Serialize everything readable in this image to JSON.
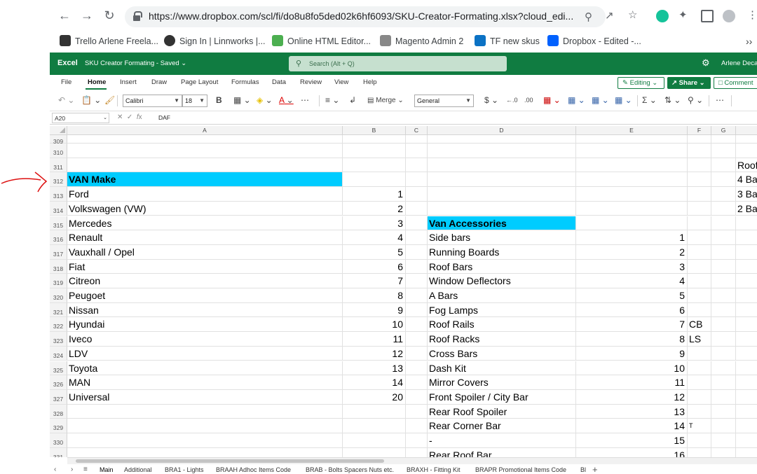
{
  "browser": {
    "url": "https://www.dropbox.com/scl/fi/do8u8fo5ded02k6hf6093/SKU-Creator-Formating.xlsx?cloud_edi...",
    "bookmarks": [
      {
        "label": "Trello Arlene Freela...",
        "color": "#333333"
      },
      {
        "label": "Sign In | Linnworks |...",
        "color": "#333333"
      },
      {
        "label": "Online HTML Editor...",
        "color": "#4caf50"
      },
      {
        "label": "Magento Admin 2",
        "color": "#666666"
      },
      {
        "label": "TF new skus",
        "color": "#0b72c4"
      },
      {
        "label": "Dropbox - Edited -...",
        "color": "#0061fe"
      }
    ]
  },
  "excel": {
    "app_name": "Excel",
    "file_title": "SKU Creator Formating - Saved",
    "search_placeholder": "Search (Alt + Q)",
    "user_name": "Arlene Deca",
    "tabs": [
      "File",
      "Home",
      "Insert",
      "Draw",
      "Page Layout",
      "Formulas",
      "Data",
      "Review",
      "View",
      "Help"
    ],
    "editing_label": "Editing",
    "share_label": "Share",
    "comments_label": "Comment",
    "font_name": "Calibri",
    "font_size": "18",
    "merge_label": "Merge",
    "number_format": "General",
    "namebox": "A20",
    "formula_value": "DAF"
  },
  "grid": {
    "columns": [
      "A",
      "B",
      "C",
      "D",
      "E",
      "F",
      "G",
      ""
    ],
    "rows": [
      {
        "n": "309",
        "a": "",
        "b": "",
        "d": "",
        "e": "",
        "f": "",
        "h": ""
      },
      {
        "n": "310",
        "a": "",
        "b": "",
        "d": "",
        "e": "",
        "f": "",
        "h": ""
      },
      {
        "n": "311",
        "a": "",
        "b": "",
        "d": "",
        "e": "",
        "f": "",
        "h": "Roof"
      },
      {
        "n": "312",
        "a": "VAN Make",
        "b": "",
        "d": "",
        "e": "",
        "f": "",
        "h": "4 Ba"
      },
      {
        "n": "313",
        "a": "Ford",
        "b": "1",
        "d": "",
        "e": "",
        "f": "",
        "h": "3 Ba"
      },
      {
        "n": "314",
        "a": "Volkswagen (VW)",
        "b": "2",
        "d": "",
        "e": "",
        "f": "",
        "h": "2 Ba"
      },
      {
        "n": "315",
        "a": "Mercedes",
        "b": "3",
        "d": "Van Accessories",
        "e": "",
        "f": "",
        "h": ""
      },
      {
        "n": "316",
        "a": "Renault",
        "b": "4",
        "d": "Side bars",
        "e": "1",
        "f": "",
        "h": ""
      },
      {
        "n": "317",
        "a": "Vauxhall / Opel",
        "b": "5",
        "d": "Running Boards",
        "e": "2",
        "f": "",
        "h": ""
      },
      {
        "n": "318",
        "a": "Fiat",
        "b": "6",
        "d": "Roof Bars",
        "e": "3",
        "f": "",
        "h": ""
      },
      {
        "n": "319",
        "a": "Citreon",
        "b": "7",
        "d": "Window Deflectors",
        "e": "4",
        "f": "",
        "h": ""
      },
      {
        "n": "320",
        "a": "Peugoet",
        "b": "8",
        "d": "A Bars",
        "e": "5",
        "f": "",
        "h": ""
      },
      {
        "n": "321",
        "a": "Nissan",
        "b": "9",
        "d": "Fog Lamps",
        "e": "6",
        "f": "",
        "h": ""
      },
      {
        "n": "322",
        "a": "Hyundai",
        "b": "10",
        "d": "Roof Rails",
        "e": "7",
        "f": "CB",
        "h": ""
      },
      {
        "n": "323",
        "a": "Iveco",
        "b": "11",
        "d": "Roof Racks",
        "e": "8",
        "f": "LS",
        "h": ""
      },
      {
        "n": "324",
        "a": "LDV",
        "b": "12",
        "d": "Cross Bars",
        "e": "9",
        "f": "",
        "h": ""
      },
      {
        "n": "325",
        "a": "Toyota",
        "b": "13",
        "d": "Dash Kit",
        "e": "10",
        "f": "",
        "h": ""
      },
      {
        "n": "326",
        "a": "MAN",
        "b": "14",
        "d": "Mirror Covers",
        "e": "11",
        "f": "",
        "h": ""
      },
      {
        "n": "327",
        "a": "Universal",
        "b": "20",
        "d": "Front Spoiler / City Bar",
        "e": "12",
        "f": "",
        "h": ""
      },
      {
        "n": "328",
        "a": "",
        "b": "",
        "d": "Rear Roof Spoiler",
        "e": "13",
        "f": "",
        "h": ""
      },
      {
        "n": "329",
        "a": "",
        "b": "",
        "d": "Rear Corner Bar",
        "e": "14",
        "f": "T",
        "h": ""
      },
      {
        "n": "330",
        "a": "",
        "b": "",
        "d": "-",
        "e": "15",
        "f": "",
        "h": ""
      },
      {
        "n": "331",
        "a": "",
        "b": "",
        "d": "Rear Roof Bar",
        "e": "16",
        "f": "",
        "h": ""
      }
    ],
    "highlight_color": "#00ccff"
  },
  "sheets": [
    "Main",
    "Additional",
    "BRA1 - Lights",
    "BRAAH Adhoc Items Code",
    "BRAB - Bolts Spacers Nuts etc.",
    "BRAXH - Fitting Kit",
    "BRAPR Promotional Items Code",
    "Bl"
  ]
}
